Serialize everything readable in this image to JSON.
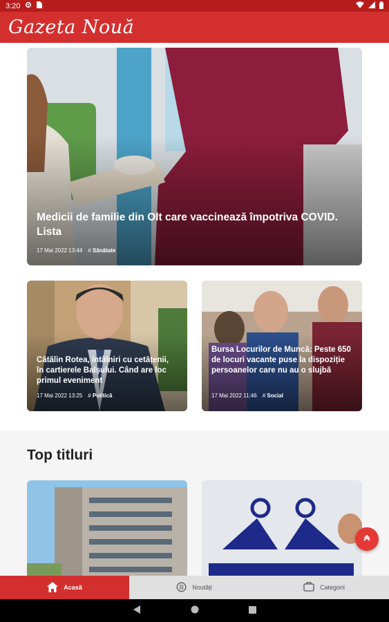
{
  "status_bar": {
    "time": "3:20"
  },
  "app": {
    "logo": "Gazeta Nouă"
  },
  "featured": {
    "title": "Medicii de familie din Olt care vaccinează împotriva COVID. Lista",
    "date": "17 Mai 2022 13:44",
    "category": "Sănătate"
  },
  "articles": [
    {
      "title": "Cătălin Rotea, întâlniri cu cetățenii, în cartierele Balșului. Când are loc primul eveniment",
      "date": "17 Mai 2022 13:25",
      "category": "Politică"
    },
    {
      "title": "Bursa Locurilor de Muncă: Peste 650 de locuri vacante puse la dispoziție persoanelor care nu au o slujbă",
      "date": "17 Mai 2022 11:46",
      "category": "Social"
    }
  ],
  "top_section": {
    "title": "Top titluri"
  },
  "bottom_nav": [
    {
      "label": "Acasă",
      "icon": "home-icon",
      "active": true
    },
    {
      "label": "Noutăți",
      "icon": "news-icon",
      "active": false
    },
    {
      "label": "Categorii",
      "icon": "categories-icon",
      "active": false
    }
  ],
  "colors": {
    "brand": "#d32f2f",
    "status_bar": "#b71c1c"
  }
}
